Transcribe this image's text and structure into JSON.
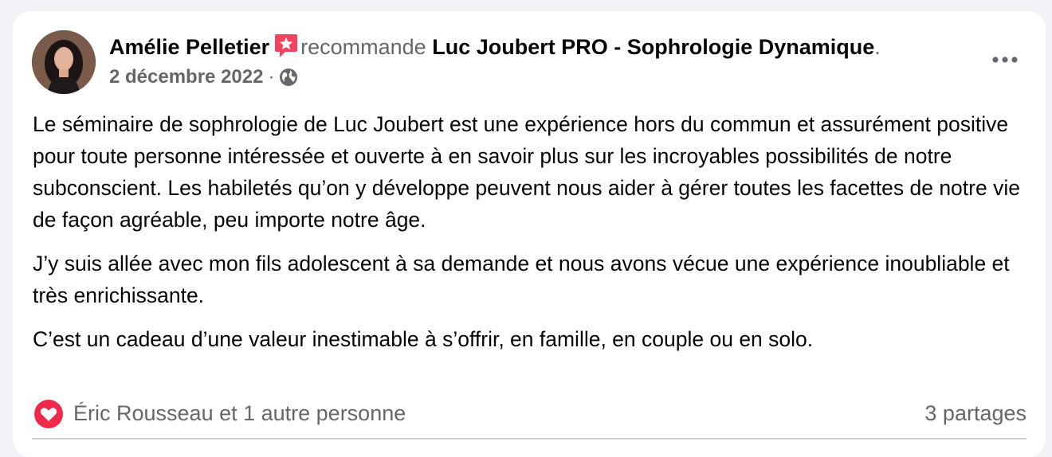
{
  "post": {
    "author": "Amélie Pelletier",
    "action": "recommande",
    "page_name": "Luc Joubert PRO - Sophrologie Dynamique",
    "trailing_dot": ".",
    "date": "2 décembre 2022",
    "date_separator": "·",
    "audience_icon": "globe-icon",
    "recommend_icon": "recommend-star-icon",
    "more_icon": "more-options-icon",
    "paragraphs": [
      "Le séminaire de sophrologie de Luc Joubert est une expérience hors du commun et assurément positive pour toute personne intéressée et ouverte à en savoir plus sur les incroyables possibilités de notre subconscient.  Les habiletés qu’on y développe peuvent nous aider à gérer toutes les facettes de notre vie de façon agréable, peu importe notre âge.",
      "J’y suis allée avec mon fils adolescent à sa demande et  nous avons vécue une expérience inoubliable et très enrichissante.",
      "C’est un cadeau d’une valeur inestimable à s’offrir, en famille, en couple ou en solo."
    ]
  },
  "footer": {
    "reaction_icon": "love-reaction-icon",
    "reactions_text": "Éric Rousseau et 1 autre personne",
    "shares_text": "3 partages"
  },
  "colors": {
    "background": "#f0f2f5",
    "card": "#ffffff",
    "text_primary": "#050505",
    "text_secondary": "#65676b",
    "recommend_accent": "#f3425f",
    "love_reaction": "#f02849"
  }
}
